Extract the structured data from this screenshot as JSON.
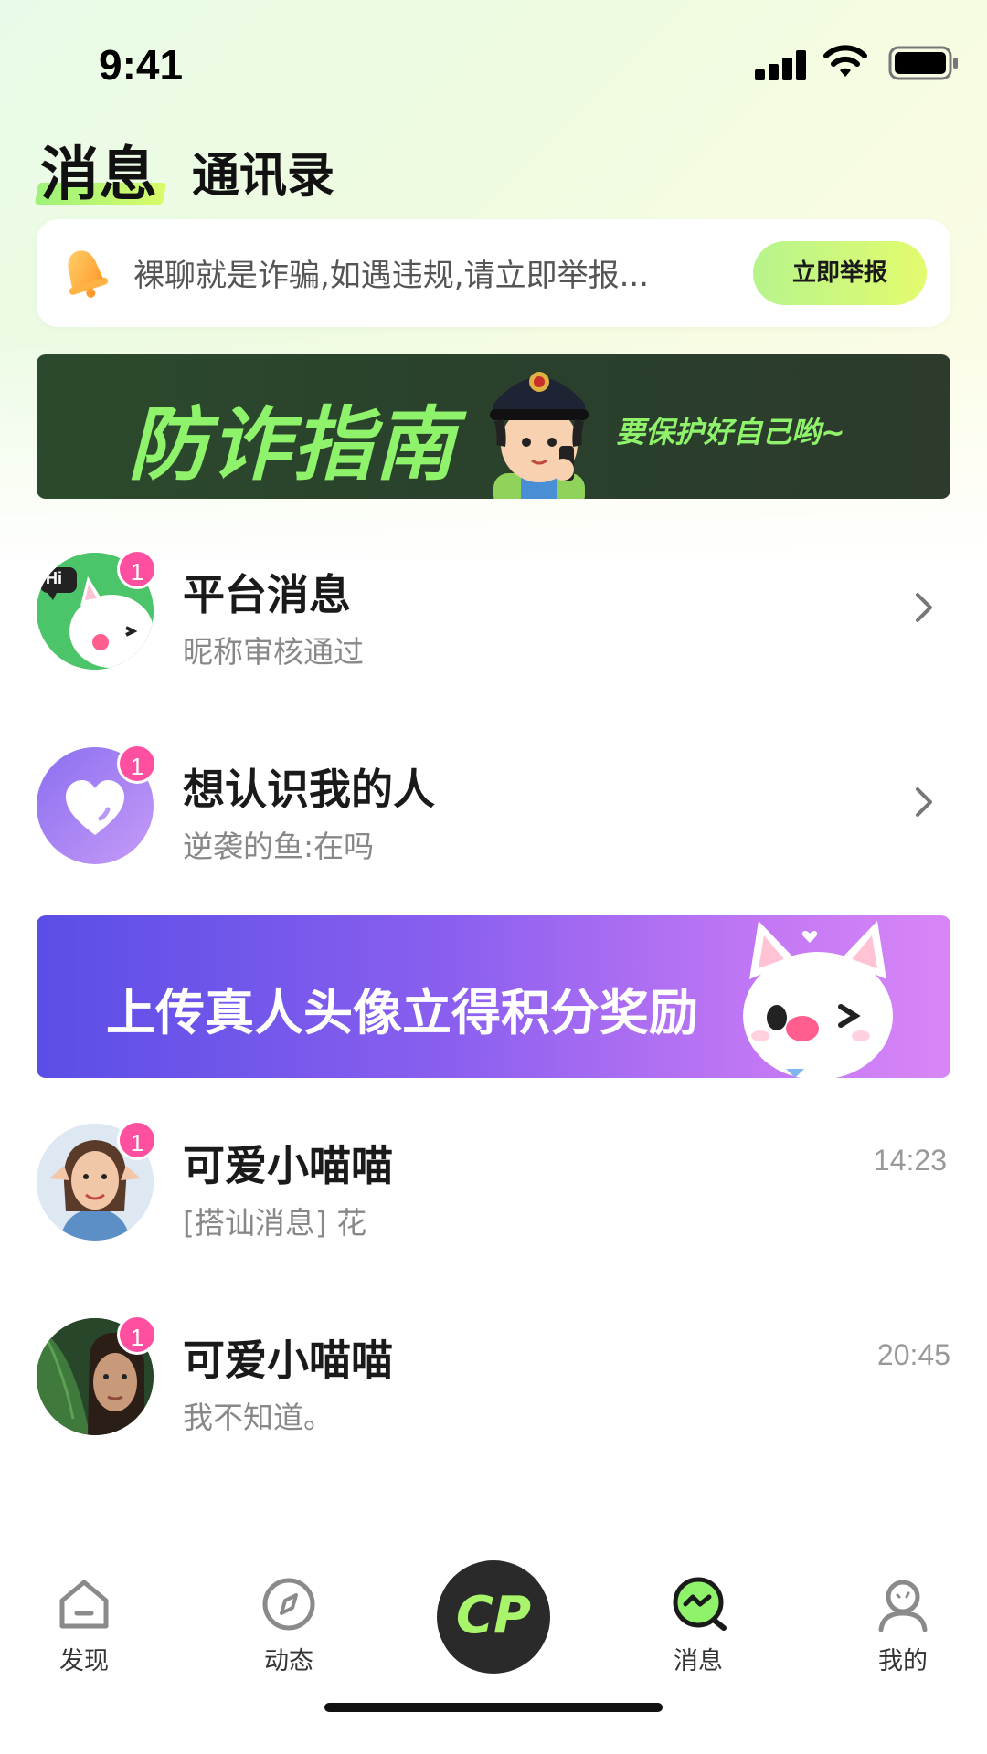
{
  "status_bar": {
    "time": "9:41"
  },
  "tabs": {
    "active": "消息",
    "inactive": "通讯录"
  },
  "notice": {
    "text": "裸聊就是诈骗,如遇违规,请立即举报...",
    "button": "立即举报",
    "icon": "bell-icon"
  },
  "fraud_banner": {
    "title": "防诈指南",
    "subtitle": "要保护好自己哟~"
  },
  "items": [
    {
      "title": "平台消息",
      "subtitle": "昵称审核通过",
      "badge": "1",
      "hi": "Hi"
    },
    {
      "title": "想认识我的人",
      "subtitle": "逆袭的鱼:在吗",
      "badge": "1"
    }
  ],
  "promo": {
    "text": "上传真人头像立得积分奖励"
  },
  "chats": [
    {
      "name": "可爱小喵喵",
      "preview": "[搭讪消息] 花",
      "time": "14:23",
      "badge": "1"
    },
    {
      "name": "可爱小喵喵",
      "preview": "我不知道。",
      "time": "20:45",
      "badge": "1"
    }
  ],
  "nav": {
    "discover": "发现",
    "moments": "动态",
    "cp": "CP",
    "messages": "消息",
    "mine": "我的"
  },
  "colors": {
    "accent_green": "#8ef26a",
    "badge_pink": "#ff4fa0",
    "promo_start": "#5a4ee6",
    "promo_end": "#d886f7"
  }
}
